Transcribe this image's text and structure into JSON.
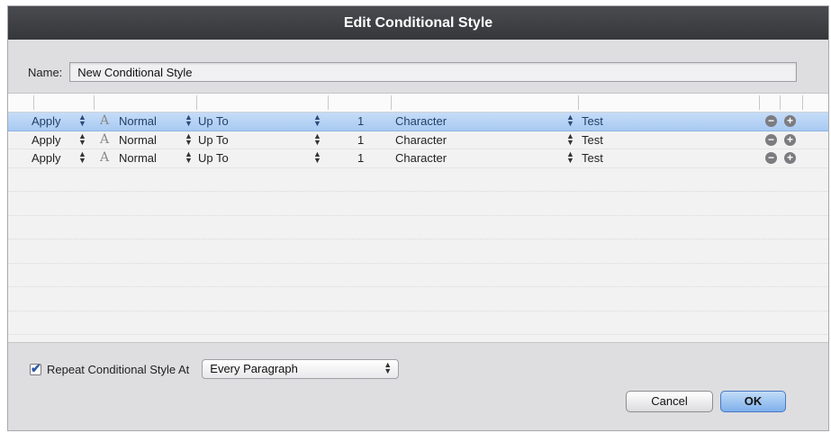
{
  "dialog": {
    "title": "Edit Conditional Style"
  },
  "name": {
    "label": "Name:",
    "value": "New Conditional Style"
  },
  "table": {
    "rows": [
      {
        "apply": "Apply",
        "style": "Normal",
        "char_icon": "A",
        "mode": "Up To",
        "count": "1",
        "unit": "Character",
        "target": "Test",
        "selected": true
      },
      {
        "apply": "Apply",
        "style": "Normal",
        "char_icon": "A",
        "mode": "Up To",
        "count": "1",
        "unit": "Character",
        "target": "Test",
        "selected": false
      },
      {
        "apply": "Apply",
        "style": "Normal",
        "char_icon": "A",
        "mode": "Up To",
        "count": "1",
        "unit": "Character",
        "target": "Test",
        "selected": false
      }
    ],
    "remove_symbol": "−",
    "add_symbol": "+",
    "selected_color": "#b6d1f4"
  },
  "repeat": {
    "label": "Repeat Conditional Style At",
    "checked": true,
    "option": "Every Paragraph"
  },
  "buttons": {
    "cancel": "Cancel",
    "ok": "OK"
  },
  "icons": {
    "checkmark": "✔",
    "stepper": "⬍"
  }
}
